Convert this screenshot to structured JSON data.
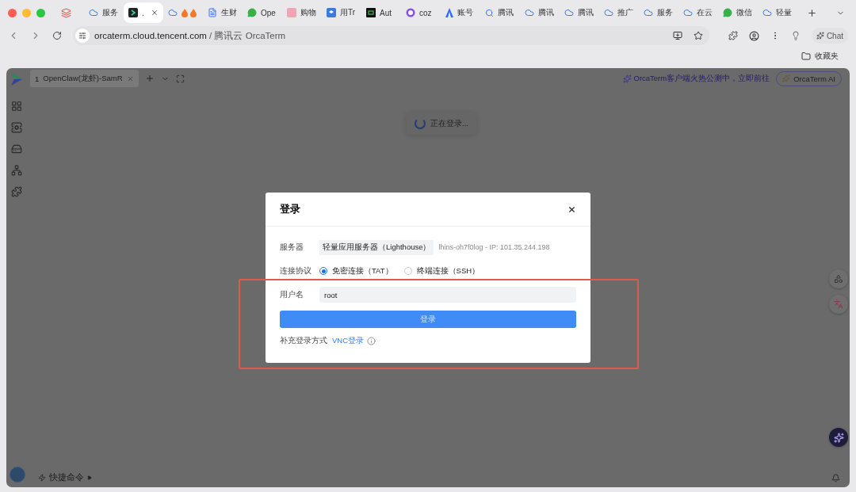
{
  "browser": {
    "tabs": [
      {
        "kind": "cloud",
        "label": "服务",
        "selected": false
      },
      {
        "kind": "terminal",
        "label": ".",
        "selected": true
      },
      {
        "kind": "fire",
        "selected": false
      },
      {
        "kind": "doc",
        "label": "生财",
        "selected": false
      },
      {
        "kind": "chat",
        "label": "Ope",
        "selected": false
      },
      {
        "kind": "shop",
        "label": "购物",
        "selected": false
      },
      {
        "kind": "app",
        "label": "用Tr",
        "selected": false
      },
      {
        "kind": "auth",
        "label": "Aut",
        "selected": false
      },
      {
        "kind": "coze",
        "label": "coz",
        "selected": false
      },
      {
        "kind": "mountain",
        "label": "账号",
        "selected": false
      },
      {
        "kind": "search",
        "label": "腾讯",
        "selected": false
      },
      {
        "kind": "cloud",
        "label": "腾讯",
        "selected": false
      },
      {
        "kind": "cloud",
        "label": "腾讯",
        "selected": false
      },
      {
        "kind": "cloud",
        "label": "推广",
        "selected": false
      },
      {
        "kind": "cloud",
        "label": "服务",
        "selected": false
      },
      {
        "kind": "cloud",
        "label": "在云",
        "selected": false
      },
      {
        "kind": "chat",
        "label": "微信",
        "selected": false
      },
      {
        "kind": "cloud",
        "label": "轻量",
        "selected": false
      }
    ],
    "address": {
      "host": "orcaterm.cloud.tencent.com",
      "title": " / 腾讯云 OrcaTerm"
    },
    "chat_button": "Chat",
    "bookmark_folder": "收藏夹"
  },
  "app": {
    "session_tabs": [
      {
        "number": "1",
        "label": "OpenClaw(龙虾)-SamR",
        "selected": true
      }
    ],
    "promo": "OrcaTerm客户端火热公测中，立即前往",
    "ai_button": "OrcaTerm AI",
    "toast": "正在登录...",
    "quick_commands": "快捷命令"
  },
  "dialog": {
    "title": "登录",
    "server": {
      "label": "服务器",
      "type": "轻量应用服务器（Lighthouse）",
      "detail": "lhins-oh7f0log - IP: 101.35.244.198"
    },
    "protocol": {
      "label": "连接协议",
      "options": [
        {
          "label": "免密连接（TAT）",
          "selected": true
        },
        {
          "label": "终端连接（SSH）",
          "selected": false
        }
      ]
    },
    "username": {
      "label": "用户名",
      "value": "root"
    },
    "submit": "登录",
    "alt": {
      "label": "补充登录方式",
      "link": "VNC登录"
    }
  }
}
